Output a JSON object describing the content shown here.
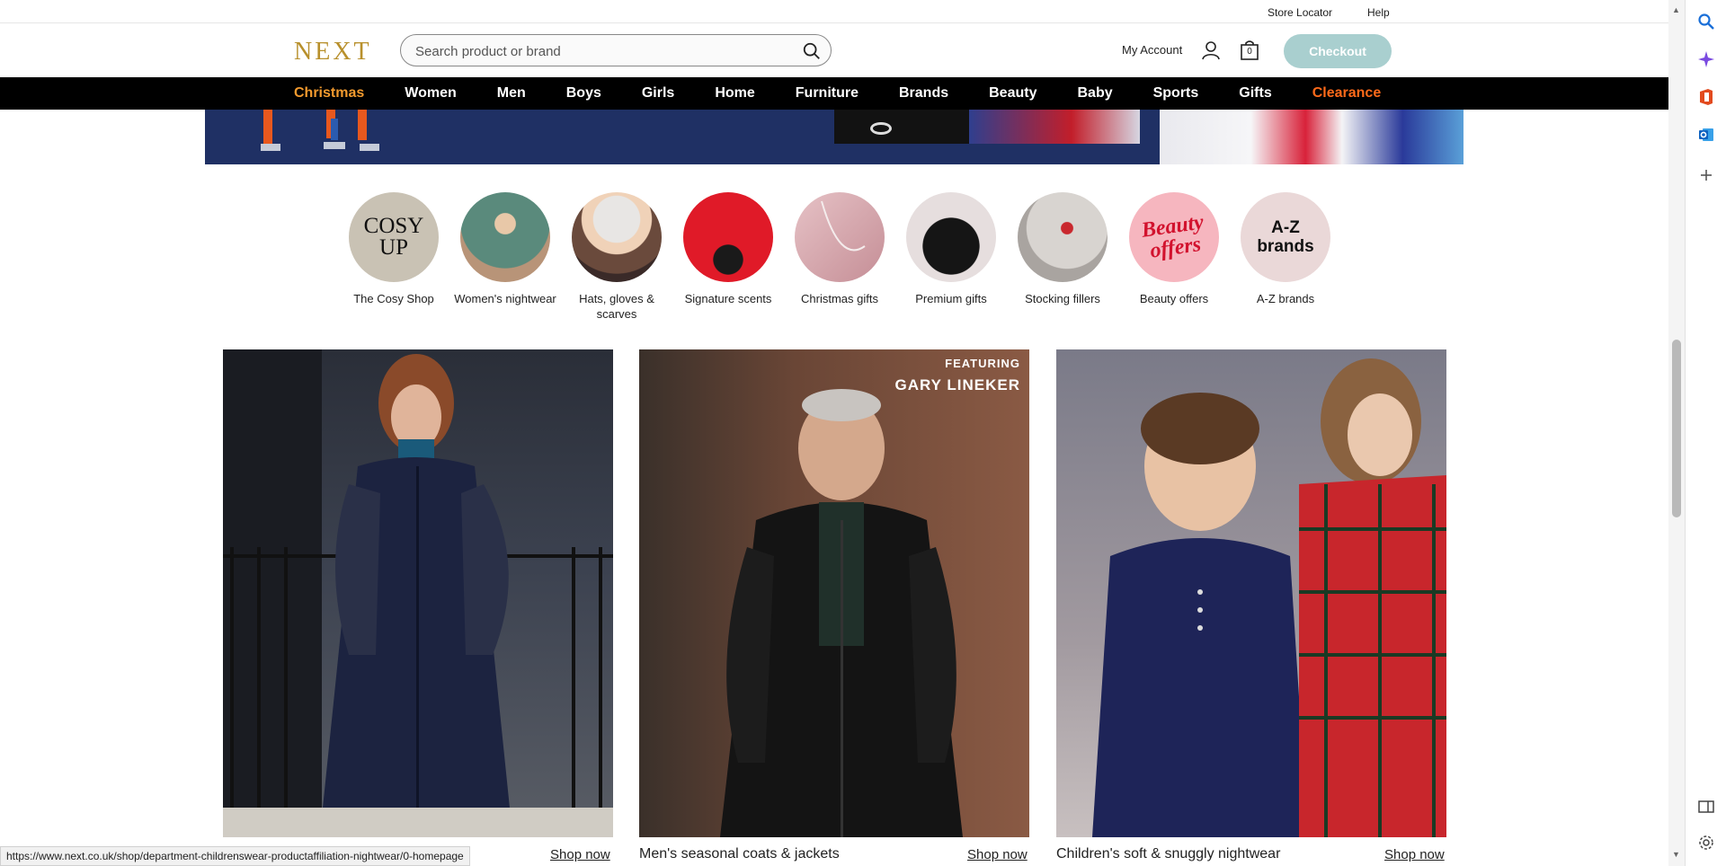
{
  "utility": {
    "store_locator": "Store Locator",
    "help": "Help"
  },
  "header": {
    "logo": "NEXT",
    "search_placeholder": "Search product or brand",
    "my_account": "My Account",
    "bag_count": "0",
    "checkout": "Checkout"
  },
  "nav": [
    "Christmas",
    "Women",
    "Men",
    "Boys",
    "Girls",
    "Home",
    "Furniture",
    "Brands",
    "Beauty",
    "Baby",
    "Sports",
    "Gifts",
    "Clearance"
  ],
  "circles": [
    {
      "label": "The Cosy Shop",
      "art": "COSY UP"
    },
    {
      "label": "Women's nightwear"
    },
    {
      "label": "Hats, gloves & scarves"
    },
    {
      "label": "Signature scents"
    },
    {
      "label": "Christmas gifts"
    },
    {
      "label": "Premium gifts"
    },
    {
      "label": "Stocking fillers"
    },
    {
      "label": "Beauty offers",
      "art": "Beauty offers"
    },
    {
      "label": "A-Z brands",
      "art": "A-Z brands"
    }
  ],
  "tiles": [
    {
      "caption": "",
      "cta": "Shop now"
    },
    {
      "caption": "Men's seasonal coats & jackets",
      "cta": "Shop now",
      "badge_top": "FEATURING",
      "badge_name": "GARY LINEKER"
    },
    {
      "caption": "Children's soft & snuggly nightwear",
      "cta": "Shop now"
    }
  ],
  "status_url": "https://www.next.co.uk/shop/department-childrenswear-productaffiliation-nightwear/0-homepage",
  "colors": {
    "brand_gold": "#b8902c",
    "nav_bg": "#000000",
    "christmas": "#f29a2e",
    "clearance": "#ff6a1a",
    "checkout_bg": "#a9cfcf"
  }
}
